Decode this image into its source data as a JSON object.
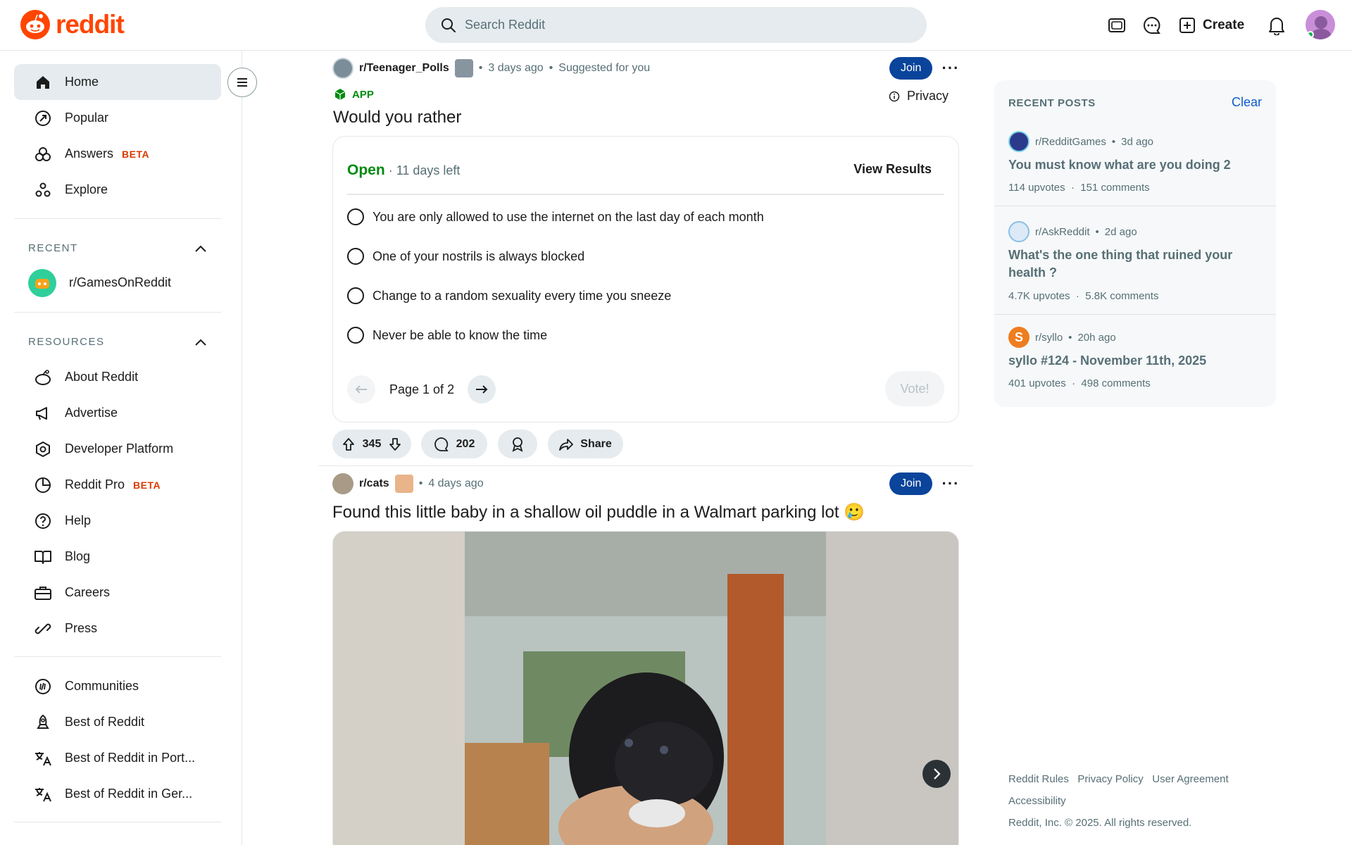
{
  "header": {
    "logo_text": "reddit",
    "search_placeholder": "Search Reddit",
    "create_label": "Create"
  },
  "sidebar": {
    "nav": [
      {
        "label": "Home",
        "icon": "home-icon"
      },
      {
        "label": "Popular",
        "icon": "popular-icon"
      },
      {
        "label": "Answers",
        "badge": "BETA",
        "icon": "answers-icon"
      },
      {
        "label": "Explore",
        "icon": "explore-icon"
      }
    ],
    "recent_heading": "RECENT",
    "recent_items": [
      {
        "label": "r/GamesOnReddit"
      }
    ],
    "resources_heading": "RESOURCES",
    "resources": [
      {
        "label": "About Reddit"
      },
      {
        "label": "Advertise"
      },
      {
        "label": "Developer Platform"
      },
      {
        "label": "Reddit Pro",
        "badge": "BETA"
      },
      {
        "label": "Help"
      },
      {
        "label": "Blog"
      },
      {
        "label": "Careers"
      },
      {
        "label": "Press"
      }
    ],
    "more": [
      {
        "label": "Communities"
      },
      {
        "label": "Best of Reddit"
      },
      {
        "label": "Best of Reddit in Port..."
      },
      {
        "label": "Best of Reddit in Ger..."
      }
    ]
  },
  "post1": {
    "subreddit": "r/Teenager_Polls",
    "time": "3 days ago",
    "suggested": "Suggested for you",
    "join_label": "Join",
    "app_label": "APP",
    "privacy_label": "Privacy",
    "title": "Would you rather",
    "poll": {
      "status": "Open",
      "days_left": "11 days left",
      "view_results": "View Results",
      "options": [
        "You are only allowed to use the internet on the last day of each month",
        "One of your nostrils is always blocked",
        "Change to a random sexuality every time you sneeze",
        "Never be able to know the time"
      ],
      "page_label": "Page 1 of 2",
      "vote_label": "Vote!"
    },
    "upvotes": "345",
    "comments": "202",
    "share_label": "Share"
  },
  "post2": {
    "subreddit": "r/cats",
    "time": "4 days ago",
    "join_label": "Join",
    "title": "Found this little baby in a shallow oil puddle in a Walmart parking lot 🥲"
  },
  "recent_posts": {
    "heading": "RECENT POSTS",
    "clear_label": "Clear",
    "items": [
      {
        "subreddit": "r/RedditGames",
        "time": "3d ago",
        "title": "You must know what are you doing 2",
        "upvotes": "114 upvotes",
        "comments": "151 comments"
      },
      {
        "subreddit": "r/AskReddit",
        "time": "2d ago",
        "title": "What's the one thing that ruined your health ?",
        "upvotes": "4.7K upvotes",
        "comments": "5.8K comments"
      },
      {
        "subreddit": "r/syllo",
        "time": "20h ago",
        "title": "syllo #124 - November 11th, 2025",
        "upvotes": "401 upvotes",
        "comments": "498 comments"
      }
    ]
  },
  "footer": {
    "links": [
      "Reddit Rules",
      "Privacy Policy",
      "User Agreement",
      "Accessibility"
    ],
    "copyright": "Reddit, Inc. © 2025. All rights reserved."
  },
  "colors": {
    "brand": "#ff4500",
    "join": "#0a449b",
    "open": "#008a10"
  }
}
